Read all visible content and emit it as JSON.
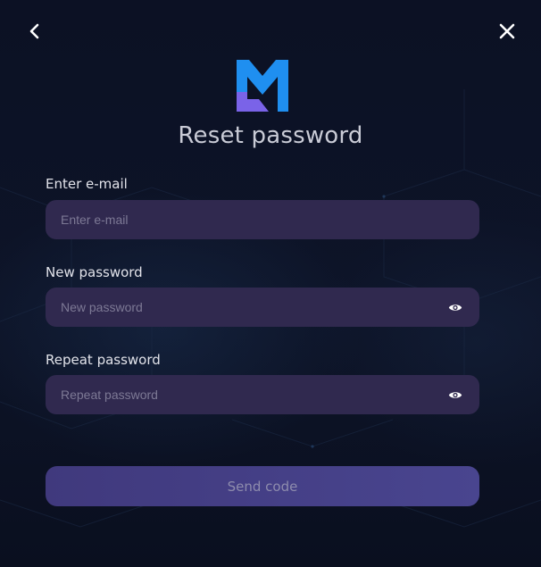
{
  "dialog": {
    "title": "Reset password",
    "back_icon": "chevron-left-icon",
    "close_icon": "close-icon",
    "logo": "m-logo",
    "colors": {
      "logo_blue": "#1f8ff0",
      "logo_purple": "#7a63e8",
      "field_bg": "#30294f",
      "button_bg": "#443f86"
    }
  },
  "form": {
    "email": {
      "label": "Enter e-mail",
      "placeholder": "Enter e-mail",
      "value": ""
    },
    "new_password": {
      "label": "New password",
      "placeholder": "New password",
      "value": "",
      "toggle_icon": "eye-icon"
    },
    "repeat_password": {
      "label": "Repeat password",
      "placeholder": "Repeat password",
      "value": "",
      "toggle_icon": "eye-icon"
    },
    "submit_label": "Send code"
  }
}
